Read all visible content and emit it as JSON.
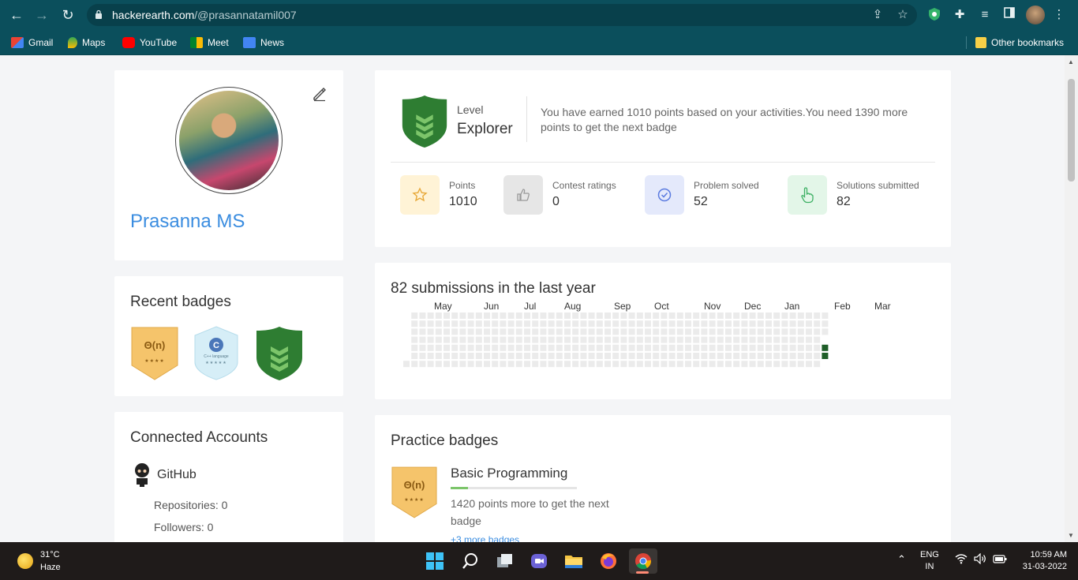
{
  "browser": {
    "url_domain": "hackerearth.com",
    "url_path": "/@prasannatamil007",
    "bookmarks": [
      "Gmail",
      "Maps",
      "YouTube",
      "Meet",
      "News"
    ],
    "other_bookmarks": "Other bookmarks"
  },
  "profile": {
    "name": "Prasanna MS"
  },
  "recent_badges": {
    "title": "Recent badges",
    "badge1_text": "Θ(n)",
    "badge1_stars": "★★★★",
    "badge2_text": "C++ language",
    "badge2_stars": "★★★★★"
  },
  "connected_accounts": {
    "title": "Connected Accounts",
    "github_label": "GitHub",
    "repositories": "Repositories: 0",
    "followers": "Followers: 0"
  },
  "level": {
    "label": "Level",
    "name": "Explorer",
    "description": "You have earned 1010 points based on your activities.You need 1390 more points to get the next badge"
  },
  "stats": [
    {
      "label": "Points",
      "value": "1010"
    },
    {
      "label": "Contest ratings",
      "value": "0"
    },
    {
      "label": "Problem solved",
      "value": "52"
    },
    {
      "label": "Solutions submitted",
      "value": "82"
    }
  ],
  "submissions": {
    "title": "82 submissions in the last year",
    "months": [
      "May",
      "Jun",
      "Jul",
      "Aug",
      "Sep",
      "Oct",
      "Nov",
      "Dec",
      "Jan",
      "Feb",
      "Mar"
    ]
  },
  "practice": {
    "title": "Practice badges",
    "badge_text": "Θ(n)",
    "badge_stars": "★★★★",
    "badge_name": "Basic Programming",
    "progress": 0.14,
    "description": "1420 points more to get the next badge",
    "more_link": "+3 more badges"
  },
  "taskbar": {
    "temperature": "31°C",
    "condition": "Haze",
    "lang1": "ENG",
    "lang2": "IN",
    "time": "10:59 AM",
    "date": "31-03-2022"
  },
  "colors": {
    "chrome": "#0b4f5c",
    "link_blue": "#3b8de0",
    "badge_green": "#2e7d32",
    "badge_gold": "#f5c46b"
  }
}
